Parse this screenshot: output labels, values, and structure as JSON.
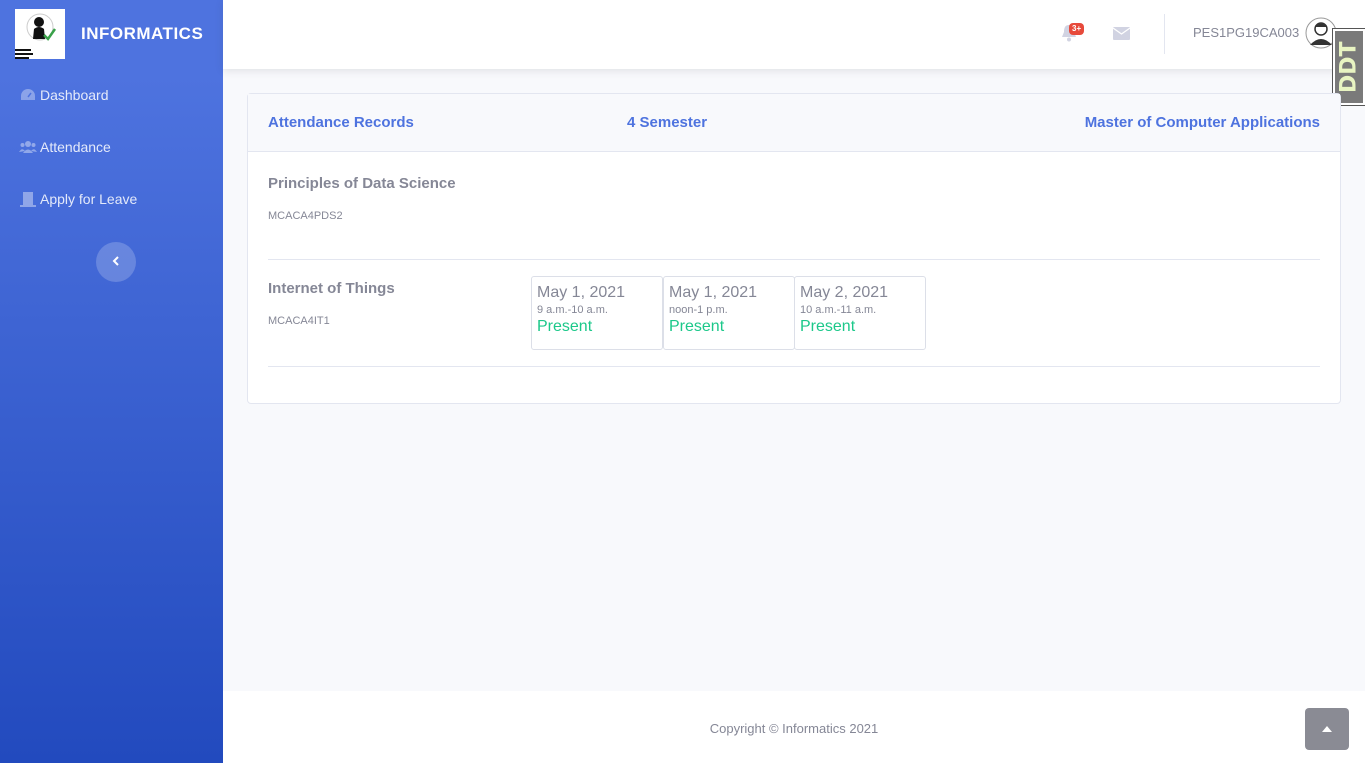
{
  "brand": {
    "name": "INFORMATICS"
  },
  "sidebar": {
    "items": [
      {
        "label": "Dashboard",
        "icon": "tachometer-icon"
      },
      {
        "label": "Attendance",
        "icon": "users-icon"
      },
      {
        "label": "Apply for Leave",
        "icon": "door-icon"
      }
    ]
  },
  "topbar": {
    "alerts_badge": "3+",
    "username": "PES1PG19CA003"
  },
  "extension_badge": "DDT",
  "card": {
    "title": "Attendance Records",
    "semester": "4 Semester",
    "program": "Master of Computer Applications"
  },
  "subjects": [
    {
      "name": "Principles of Data Science",
      "code": "MCACA4PDS2"
    },
    {
      "name": "Internet of Things",
      "code": "MCACA4IT1"
    }
  ],
  "attendance": [
    {
      "date": "May 1, 2021",
      "time": "9 a.m.-10 a.m.",
      "status": "Present"
    },
    {
      "date": "May 1, 2021",
      "time": "noon-1 p.m.",
      "status": "Present"
    },
    {
      "date": "May 2, 2021",
      "time": "10 a.m.-11 a.m.",
      "status": "Present"
    }
  ],
  "footer": {
    "copyright": "Copyright © Informatics 2021"
  },
  "colors": {
    "primary": "#4e73df",
    "success": "#1cc88a",
    "danger": "#e74a3b"
  }
}
